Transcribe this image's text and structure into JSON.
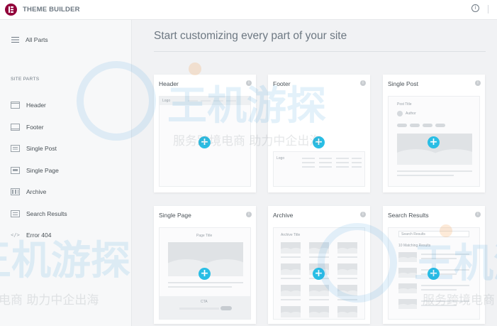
{
  "header": {
    "app_title": "THEME BUILDER",
    "info_icon": "i"
  },
  "sidebar": {
    "all_parts_label": "All Parts",
    "section_label": "SITE PARTS",
    "items": [
      {
        "label": "Header",
        "icon": "header-icon"
      },
      {
        "label": "Footer",
        "icon": "footer-icon"
      },
      {
        "label": "Single Post",
        "icon": "single-post-icon"
      },
      {
        "label": "Single Page",
        "icon": "single-page-icon"
      },
      {
        "label": "Archive",
        "icon": "archive-icon"
      },
      {
        "label": "Search Results",
        "icon": "search-results-icon"
      },
      {
        "label": "Error 404",
        "icon": "error-404-icon",
        "icon_glyph": "</>"
      }
    ]
  },
  "main": {
    "title": "Start customizing every part of your site",
    "cards": [
      {
        "title": "Header",
        "preview_text": "Logo"
      },
      {
        "title": "Footer",
        "preview_text": "Logo"
      },
      {
        "title": "Single Post",
        "preview_text": "Post Title",
        "preview_subtext": "Author"
      },
      {
        "title": "Single Page",
        "preview_text": "Page Title",
        "preview_subtext": "CTA"
      },
      {
        "title": "Archive",
        "preview_text": "Archive Title"
      },
      {
        "title": "Search Results",
        "preview_text": "Search Results",
        "preview_subtext": "10 Matching Results"
      }
    ],
    "add_symbol": "+",
    "info_symbol": "i"
  },
  "watermark": {
    "brand_text": "王机游探",
    "slogan_text": "服务跨境电商 助力中企出海"
  },
  "colors": {
    "brand": "#92003b",
    "accent": "#29bee5",
    "sidebar_bg": "#f7f8f9",
    "main_bg": "#f1f2f4"
  }
}
